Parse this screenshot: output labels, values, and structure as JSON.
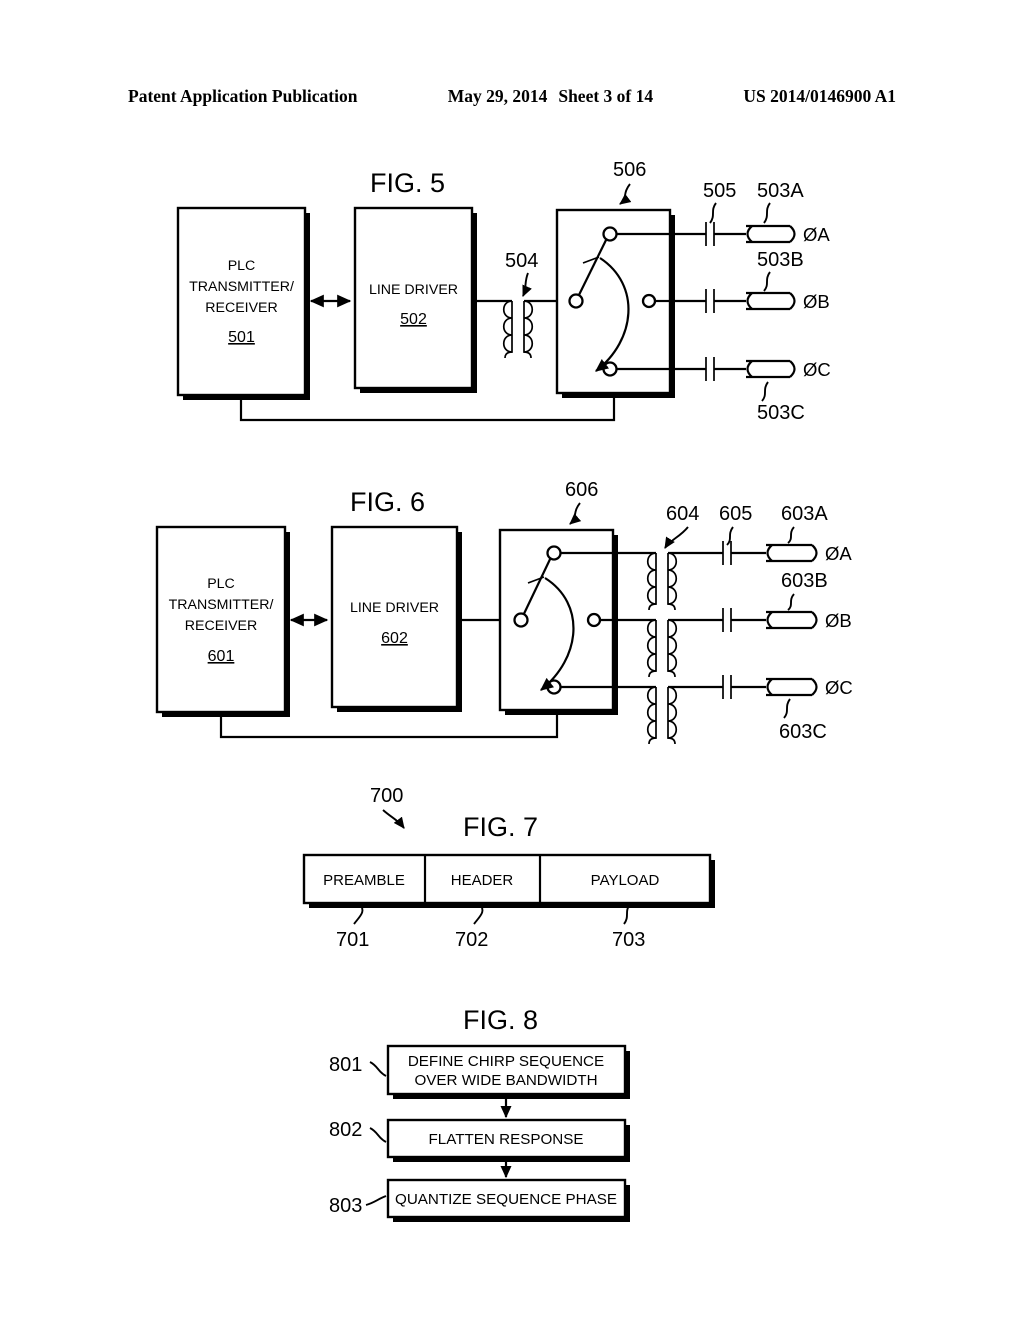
{
  "header": {
    "publication": "Patent Application Publication",
    "date": "May 29, 2014",
    "sheet": "Sheet 3 of 14",
    "patent_number": "US 2014/0146900 A1"
  },
  "figures": [
    {
      "id": "fig5",
      "label": "FIG. 5",
      "blocks": [
        {
          "name": "plc-transmitter-receiver",
          "lines": [
            "PLC",
            "TRANSMITTER/",
            "RECEIVER"
          ],
          "ref": "501"
        },
        {
          "name": "line-driver",
          "lines": [
            "LINE DRIVER"
          ],
          "ref": "502"
        },
        {
          "name": "phase-selector-switch",
          "lines": [],
          "ref": "506"
        }
      ],
      "refs": {
        "transformer": "504",
        "coupling_capacitor": "505",
        "switch_box": "506",
        "line_a": "503A",
        "line_b": "503B",
        "line_c": "503C"
      },
      "phase_labels": {
        "a": "ØA",
        "b": "ØB",
        "c": "ØC"
      }
    },
    {
      "id": "fig6",
      "label": "FIG. 6",
      "blocks": [
        {
          "name": "plc-transmitter-receiver",
          "lines": [
            "PLC",
            "TRANSMITTER/",
            "RECEIVER"
          ],
          "ref": "601"
        },
        {
          "name": "line-driver",
          "lines": [
            "LINE DRIVER"
          ],
          "ref": "602"
        },
        {
          "name": "phase-selector-switch",
          "lines": [],
          "ref": "606"
        }
      ],
      "refs": {
        "transformer": "604",
        "coupling_capacitor": "605",
        "switch_box": "606",
        "line_a": "603A",
        "line_b": "603B",
        "line_c": "603C"
      },
      "phase_labels": {
        "a": "ØA",
        "b": "ØB",
        "c": "ØC"
      }
    },
    {
      "id": "fig7",
      "label": "FIG. 7",
      "packet_ref": "700",
      "fields": [
        {
          "label": "PREAMBLE",
          "ref": "701"
        },
        {
          "label": "HEADER",
          "ref": "702"
        },
        {
          "label": "PAYLOAD",
          "ref": "703"
        }
      ]
    },
    {
      "id": "fig8",
      "label": "FIG. 8",
      "steps": [
        {
          "ref": "801",
          "lines": [
            "DEFINE CHIRP SEQUENCE",
            "OVER WIDE BANDWIDTH"
          ]
        },
        {
          "ref": "802",
          "lines": [
            "FLATTEN RESPONSE"
          ]
        },
        {
          "ref": "803",
          "lines": [
            "QUANTIZE SEQUENCE PHASE"
          ]
        }
      ]
    }
  ],
  "colors": {
    "ink": "#000000",
    "paper": "#ffffff"
  }
}
